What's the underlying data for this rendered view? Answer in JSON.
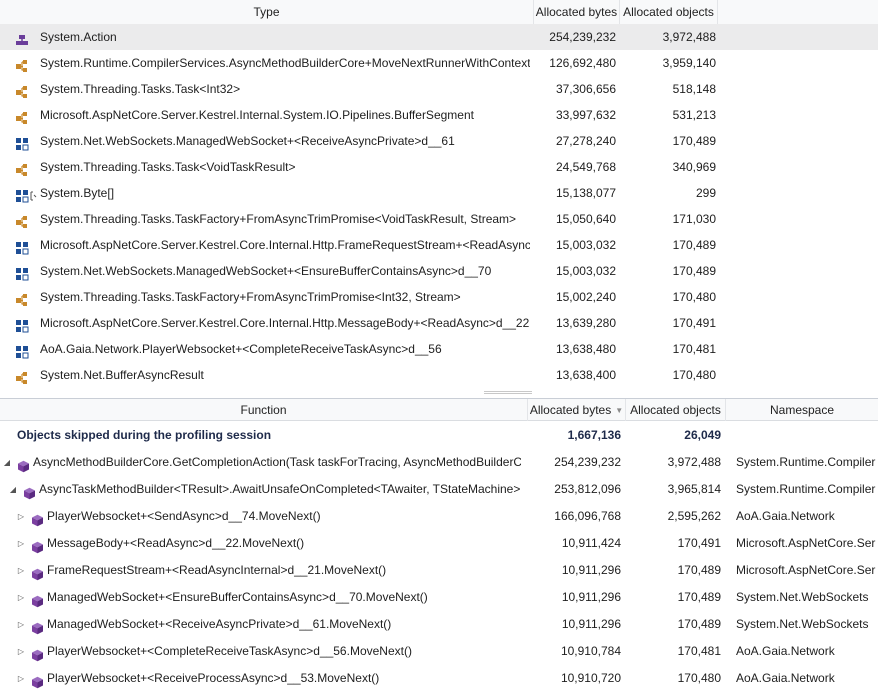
{
  "top_table": {
    "columns": {
      "type": "Type",
      "allocated_bytes": "Allocated bytes",
      "allocated_objects": "Allocated objects"
    },
    "rows": [
      {
        "icon": "delegate-icon",
        "type": "System.Action",
        "bytes": "254,239,232",
        "objects": "3,972,488",
        "selected": true
      },
      {
        "icon": "class-icon",
        "type": "System.Runtime.CompilerServices.AsyncMethodBuilderCore+MoveNextRunnerWithContext",
        "bytes": "126,692,480",
        "objects": "3,959,140"
      },
      {
        "icon": "class-icon",
        "type": "System.Threading.Tasks.Task<Int32>",
        "bytes": "37,306,656",
        "objects": "518,148"
      },
      {
        "icon": "class-icon",
        "type": "Microsoft.AspNetCore.Server.Kestrel.Internal.System.IO.Pipelines.BufferSegment",
        "bytes": "33,997,632",
        "objects": "531,213"
      },
      {
        "icon": "struct-icon",
        "type": "System.Net.WebSockets.ManagedWebSocket+<ReceiveAsyncPrivate>d__61",
        "bytes": "27,278,240",
        "objects": "170,489"
      },
      {
        "icon": "class-icon",
        "type": "System.Threading.Tasks.Task<VoidTaskResult>",
        "bytes": "24,549,768",
        "objects": "340,969"
      },
      {
        "icon": "array-struct-icon",
        "type": "System.Byte[]",
        "bytes": "15,138,077",
        "objects": "299"
      },
      {
        "icon": "class-icon",
        "type": "System.Threading.Tasks.TaskFactory+FromAsyncTrimPromise<VoidTaskResult, Stream>",
        "bytes": "15,050,640",
        "objects": "171,030"
      },
      {
        "icon": "struct-icon",
        "type": "Microsoft.AspNetCore.Server.Kestrel.Core.Internal.Http.FrameRequestStream+<ReadAsyncInt",
        "bytes": "15,003,032",
        "objects": "170,489"
      },
      {
        "icon": "struct-icon",
        "type": "System.Net.WebSockets.ManagedWebSocket+<EnsureBufferContainsAsync>d__70",
        "bytes": "15,003,032",
        "objects": "170,489"
      },
      {
        "icon": "class-icon",
        "type": "System.Threading.Tasks.TaskFactory+FromAsyncTrimPromise<Int32, Stream>",
        "bytes": "15,002,240",
        "objects": "170,480"
      },
      {
        "icon": "struct-icon",
        "type": "Microsoft.AspNetCore.Server.Kestrel.Core.Internal.Http.MessageBody+<ReadAsync>d__22",
        "bytes": "13,639,280",
        "objects": "170,491"
      },
      {
        "icon": "struct-icon",
        "type": "AoA.Gaia.Network.PlayerWebsocket+<CompleteReceiveTaskAsync>d__56",
        "bytes": "13,638,480",
        "objects": "170,481"
      },
      {
        "icon": "class-icon",
        "type": "System.Net.BufferAsyncResult",
        "bytes": "13,638,400",
        "objects": "170,480"
      }
    ]
  },
  "bottom_table": {
    "columns": {
      "function": "Function",
      "allocated_bytes": "Allocated bytes",
      "allocated_objects": "Allocated objects",
      "namespace": "Namespace"
    },
    "skipped": {
      "label": "Objects skipped during the profiling session",
      "bytes": "1,667,136",
      "objects": "26,049"
    },
    "rows": [
      {
        "level": 0,
        "expander": "expanded",
        "function": "AsyncMethodBuilderCore.GetCompletionAction(Task taskForTracing, AsyncMethodBuilderCo",
        "bytes": "254,239,232",
        "objects": "3,972,488",
        "namespace": "System.Runtime.Compiler"
      },
      {
        "level": 1,
        "expander": "expanded",
        "function": "AsyncTaskMethodBuilder<TResult>.AwaitUnsafeOnCompleted<TAwaiter, TStateMachine>(T",
        "bytes": "253,812,096",
        "objects": "3,965,814",
        "namespace": "System.Runtime.Compiler"
      },
      {
        "level": 2,
        "expander": "collapsed",
        "function": "PlayerWebsocket+<SendAsync>d__74.MoveNext()",
        "bytes": "166,096,768",
        "objects": "2,595,262",
        "namespace": "AoA.Gaia.Network"
      },
      {
        "level": 2,
        "expander": "collapsed",
        "function": "MessageBody+<ReadAsync>d__22.MoveNext()",
        "bytes": "10,911,424",
        "objects": "170,491",
        "namespace": "Microsoft.AspNetCore.Ser"
      },
      {
        "level": 2,
        "expander": "collapsed",
        "function": "FrameRequestStream+<ReadAsyncInternal>d__21.MoveNext()",
        "bytes": "10,911,296",
        "objects": "170,489",
        "namespace": "Microsoft.AspNetCore.Ser"
      },
      {
        "level": 2,
        "expander": "collapsed",
        "function": "ManagedWebSocket+<EnsureBufferContainsAsync>d__70.MoveNext()",
        "bytes": "10,911,296",
        "objects": "170,489",
        "namespace": "System.Net.WebSockets"
      },
      {
        "level": 2,
        "expander": "collapsed",
        "function": "ManagedWebSocket+<ReceiveAsyncPrivate>d__61.MoveNext()",
        "bytes": "10,911,296",
        "objects": "170,489",
        "namespace": "System.Net.WebSockets"
      },
      {
        "level": 2,
        "expander": "collapsed",
        "function": "PlayerWebsocket+<CompleteReceiveTaskAsync>d__56.MoveNext()",
        "bytes": "10,910,784",
        "objects": "170,481",
        "namespace": "AoA.Gaia.Network"
      },
      {
        "level": 2,
        "expander": "collapsed",
        "function": "PlayerWebsocket+<ReceiveProcessAsync>d__53.MoveNext()",
        "bytes": "10,910,720",
        "objects": "170,480",
        "namespace": "AoA.Gaia.Network"
      }
    ]
  },
  "colors": {
    "class_icon": "#c8882a",
    "struct_icon": "#1f4f96",
    "method_icon": "#7b3fa0",
    "delegate_icon": "#6a3d9a",
    "selection": "#ebebec"
  }
}
